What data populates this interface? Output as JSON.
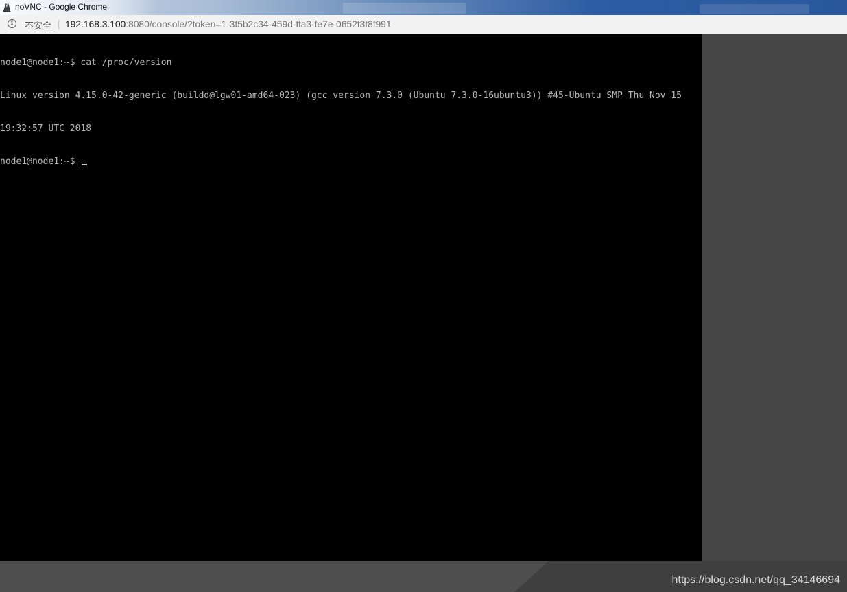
{
  "window": {
    "title": "noVNC - Google Chrome",
    "icon": "novnc-app-icon"
  },
  "addressbar": {
    "security_label": "不安全",
    "url_host": "192.168.3.100",
    "url_rest": ":8080/console/?token=1-3f5b2c34-459d-ffa3-fe7e-0652f3f8f991"
  },
  "terminal": {
    "lines": [
      "node1@node1:~$ cat /proc/version",
      "Linux version 4.15.0-42-generic (buildd@lgw01-amd64-023) (gcc version 7.3.0 (Ubuntu 7.3.0-16ubuntu3)) #45-Ubuntu SMP Thu Nov 15",
      "19:32:57 UTC 2018"
    ],
    "prompt": "node1@node1:~$ "
  },
  "watermark": "https://blog.csdn.net/qq_34146694",
  "colors": {
    "terminal_bg": "#000000",
    "terminal_fg": "#b8b8b8",
    "viewport_bg": "#464646"
  }
}
